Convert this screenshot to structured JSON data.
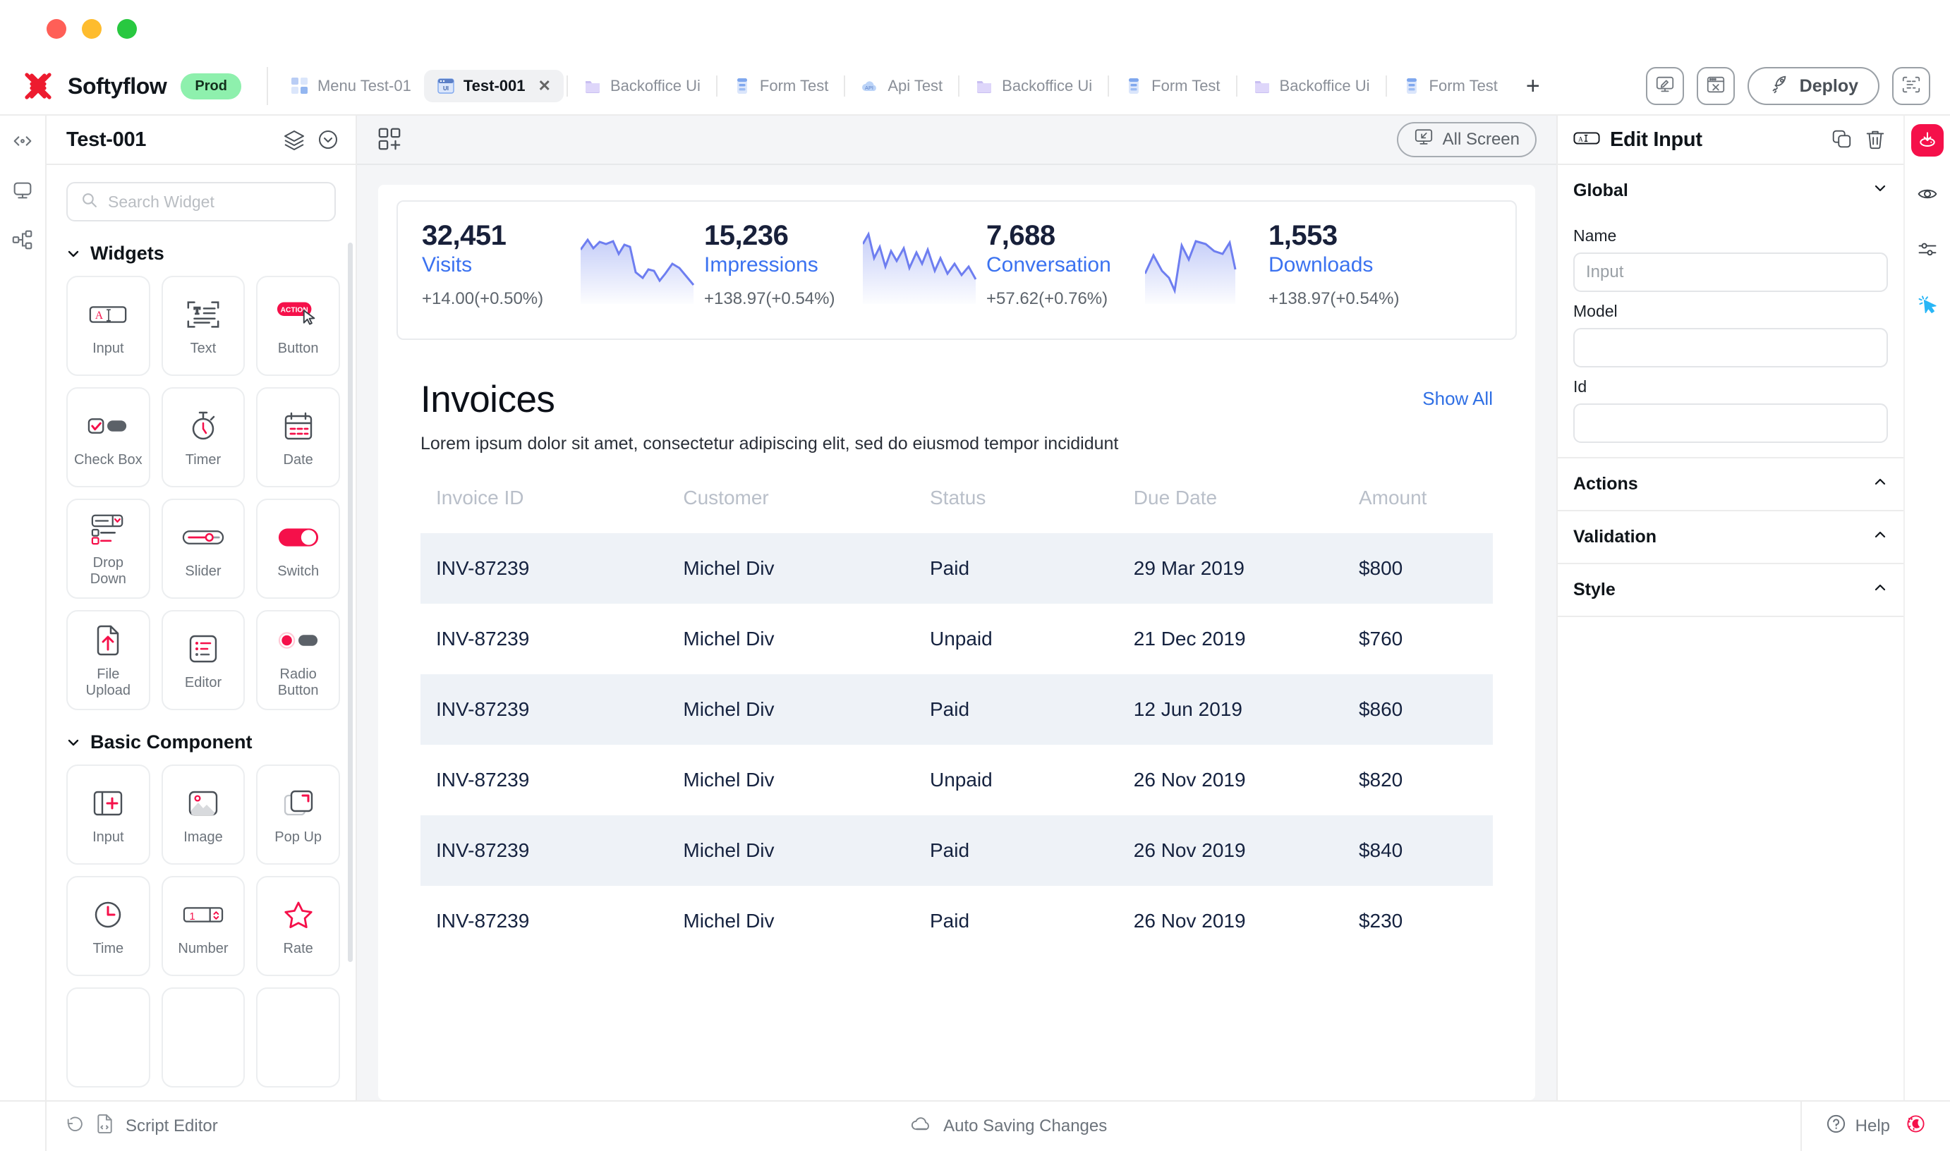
{
  "window": {
    "title": "Softyflow"
  },
  "brand": {
    "name": "Softyflow",
    "badge": "Prod",
    "logo_icon": "x-logo-icon"
  },
  "tabs": [
    {
      "label": "Menu Test-01",
      "icon": "menu-grid-icon",
      "active": false,
      "closable": false
    },
    {
      "label": "Test-001",
      "icon": "ui-window-icon",
      "active": true,
      "closable": true,
      "close_label": "✕"
    },
    {
      "label": "Backoffice Ui",
      "icon": "folder-icon",
      "active": false,
      "closable": false
    },
    {
      "label": "Form Test",
      "icon": "form-icon",
      "active": false,
      "closable": false
    },
    {
      "label": "Api Test",
      "icon": "api-cloud-icon",
      "active": false,
      "closable": false
    },
    {
      "label": "Backoffice Ui",
      "icon": "folder-icon",
      "active": false,
      "closable": false
    },
    {
      "label": "Form Test",
      "icon": "form-icon",
      "active": false,
      "closable": false
    },
    {
      "label": "Backoffice Ui",
      "icon": "folder-icon",
      "active": false,
      "closable": false
    },
    {
      "label": "Form Test",
      "icon": "form-icon",
      "active": false,
      "closable": false
    }
  ],
  "tab_add_label": "+",
  "topright": {
    "theme_icon": "paint-screen-icon",
    "tools_icon": "window-tools-icon",
    "deploy_label": "Deploy",
    "deploy_icon": "rocket-icon",
    "code_icon": "code-scan-icon"
  },
  "left_rail": [
    {
      "icon": "collapse-arrows-icon",
      "name": "collapse-panel"
    },
    {
      "icon": "monitor-icon",
      "name": "screens"
    },
    {
      "icon": "sitemap-icon",
      "name": "tree-view"
    }
  ],
  "left_panel": {
    "title": "Test-001",
    "layers_icon": "layers-icon",
    "chevron_icon": "chevron-down-circle-icon",
    "search": {
      "placeholder": "Search Widget",
      "value": "",
      "icon": "search-icon"
    },
    "sections": [
      {
        "title": "Widgets",
        "expanded": true,
        "items": [
          {
            "label": "Input",
            "icon": "text-input-icon"
          },
          {
            "label": "Text",
            "icon": "text-block-icon"
          },
          {
            "label": "Button",
            "icon": "action-button-icon",
            "badge": "ACTION"
          },
          {
            "label": "Check Box",
            "icon": "checkbox-icon"
          },
          {
            "label": "Timer",
            "icon": "stopwatch-icon"
          },
          {
            "label": "Date",
            "icon": "calendar-icon"
          },
          {
            "label": "Drop Down",
            "icon": "dropdown-icon"
          },
          {
            "label": "Slider",
            "icon": "slider-icon"
          },
          {
            "label": "Switch",
            "icon": "switch-icon"
          },
          {
            "label": "File Upload",
            "icon": "file-upload-icon"
          },
          {
            "label": "Editor",
            "icon": "list-editor-icon"
          },
          {
            "label": "Radio Button",
            "icon": "radio-button-icon"
          }
        ]
      },
      {
        "title": "Basic Component",
        "expanded": true,
        "items": [
          {
            "label": "Input",
            "icon": "split-input-icon"
          },
          {
            "label": "Image",
            "icon": "image-icon"
          },
          {
            "label": "Pop Up",
            "icon": "popup-icon"
          },
          {
            "label": "Time",
            "icon": "clock-icon"
          },
          {
            "label": "Number",
            "icon": "number-stepper-icon"
          },
          {
            "label": "Rate",
            "icon": "star-icon"
          },
          {
            "label": "",
            "icon": ""
          },
          {
            "label": "",
            "icon": ""
          },
          {
            "label": "",
            "icon": ""
          }
        ]
      }
    ]
  },
  "canvas": {
    "add_widget_icon": "add-grid-icon",
    "all_screen_label": "All Screen",
    "all_screen_icon": "screen-select-icon",
    "stats": [
      {
        "value": "32,451",
        "label": "Visits",
        "delta": "+14.00(+0.50%)"
      },
      {
        "value": "15,236",
        "label": "Impressions",
        "delta": "+138.97(+0.54%)"
      },
      {
        "value": "7,688",
        "label": "Conversation",
        "delta": "+57.62(+0.76%)"
      },
      {
        "value": "1,553",
        "label": "Downloads",
        "delta": "+138.97(+0.54%)"
      }
    ],
    "invoices": {
      "title": "Invoices",
      "subtitle": "Lorem ipsum dolor sit amet, consectetur adipiscing elit, sed do eiusmod tempor incididunt",
      "show_all": "Show All",
      "columns": [
        "Invoice ID",
        "Customer",
        "Status",
        "Due Date",
        "Amount"
      ],
      "rows": [
        {
          "id": "INV-87239",
          "customer": "Michel Div",
          "status": "Paid",
          "due": "29 Mar 2019",
          "amount": "$800",
          "alt": true
        },
        {
          "id": "INV-87239",
          "customer": "Michel Div",
          "status": "Unpaid",
          "due": "21 Dec 2019",
          "amount": "$760",
          "alt": false
        },
        {
          "id": "INV-87239",
          "customer": "Michel Div",
          "status": "Paid",
          "due": "12 Jun 2019",
          "amount": "$860",
          "alt": true
        },
        {
          "id": "INV-87239",
          "customer": "Michel Div",
          "status": "Unpaid",
          "due": "26 Nov 2019",
          "amount": "$820",
          "alt": false
        },
        {
          "id": "INV-87239",
          "customer": "Michel Div",
          "status": "Paid",
          "due": "26 Nov 2019",
          "amount": "$840",
          "alt": true
        },
        {
          "id": "INV-87239",
          "customer": "Michel Div",
          "status": "Paid",
          "due": "26 Nov 2019",
          "amount": "$230",
          "alt": false
        }
      ]
    }
  },
  "right_panel": {
    "title": "Edit Input",
    "title_icon": "input-field-icon",
    "copy_icon": "copy-icon",
    "delete_icon": "trash-icon",
    "global": {
      "section_label": "Global",
      "name_label": "Name",
      "name_placeholder": "Input",
      "name_value": "",
      "model_label": "Model",
      "model_value": "",
      "id_label": "Id",
      "id_value": ""
    },
    "sections": [
      {
        "label": "Actions",
        "expanded": false
      },
      {
        "label": "Validation",
        "expanded": false
      },
      {
        "label": "Style",
        "expanded": false
      }
    ]
  },
  "right_rail": [
    {
      "icon": "save-download-icon",
      "name": "save-button",
      "primary": true
    },
    {
      "icon": "eye-icon",
      "name": "preview-button",
      "primary": false
    },
    {
      "icon": "sliders-icon",
      "name": "settings-button",
      "primary": false
    },
    {
      "icon": "cursor-click-icon",
      "name": "interact-button",
      "primary": false
    }
  ],
  "bottombar": {
    "history_icon": "history-icon",
    "script_icon": "script-file-icon",
    "script_label": "Script Editor",
    "autosave_icon": "cloud-sync-icon",
    "autosave_label": "Auto Saving Changes",
    "help_icon": "help-circle-icon",
    "help_label": "Help",
    "theme_icon": "day-night-icon"
  },
  "colors": {
    "accent_red": "#f5104a",
    "link_blue": "#2f6fe4",
    "stat_blue": "#3b72f0",
    "badge_green": "#8ef0ad",
    "row_alt": "#eef2f7"
  }
}
